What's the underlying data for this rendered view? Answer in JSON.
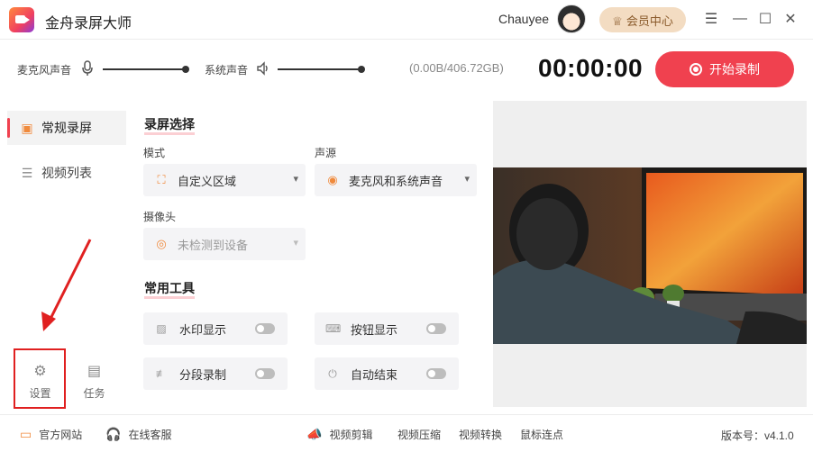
{
  "app": {
    "title": "金舟录屏大师"
  },
  "user": {
    "name": "Chauyee"
  },
  "header": {
    "vip_label": "会员中心",
    "minimize": "—",
    "maximize": "☐",
    "close": "✕",
    "menu": "☰"
  },
  "audio": {
    "mic_label": "麦克风声音",
    "system_label": "系统声音",
    "mic_level": 1.0,
    "system_level": 1.0
  },
  "storage": {
    "text": "(0.00B/406.72GB)"
  },
  "timer": {
    "text": "00:00:00"
  },
  "record": {
    "label": "开始录制"
  },
  "sidebar": {
    "items": [
      {
        "label": "常规录屏",
        "active": true
      },
      {
        "label": "视频列表",
        "active": false
      }
    ],
    "settings_label": "设置",
    "tasks_label": "任务"
  },
  "panel": {
    "capture_title": "录屏选择",
    "mode_label": "模式",
    "mode_value": "自定义区域",
    "audio_source_label": "声源",
    "audio_source_value": "麦克风和系统声音",
    "camera_label": "摄像头",
    "camera_value": "未检测到设备",
    "tools_title": "常用工具",
    "tools": [
      {
        "label": "水印显示",
        "on": false
      },
      {
        "label": "按钮显示",
        "on": false
      },
      {
        "label": "分段录制",
        "on": false
      },
      {
        "label": "自动结束",
        "on": false
      }
    ]
  },
  "footer": {
    "website": "官方网站",
    "support": "在线客服",
    "video_edit": "视频剪辑",
    "video_compress": "视频压缩",
    "video_convert": "视频转换",
    "mouse_click": "鼠标连点",
    "version": "版本号：v4.1.0"
  },
  "colors": {
    "accent": "#f0414f",
    "icon_orange": "#f08a3c",
    "vip_bg": "#f3dcc2"
  }
}
